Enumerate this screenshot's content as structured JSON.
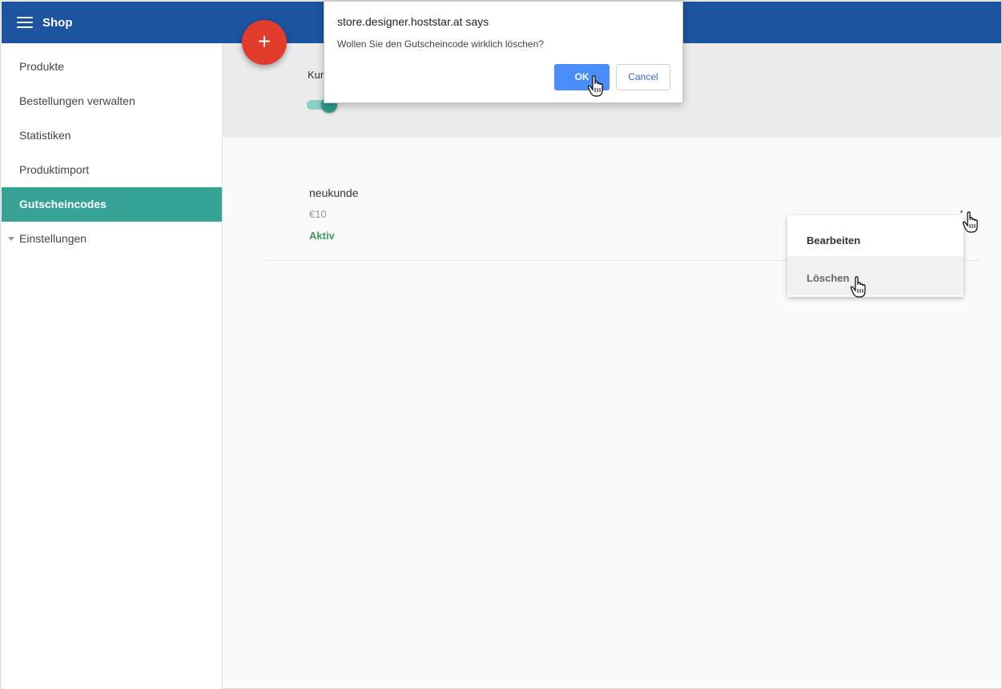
{
  "app": {
    "title": "Shop",
    "menu_icon": "hamburger-menu-icon"
  },
  "sidebar": {
    "items": [
      {
        "label": "Produkte"
      },
      {
        "label": "Bestellungen verwalten"
      },
      {
        "label": "Statistiken"
      },
      {
        "label": "Produktimport"
      },
      {
        "label": "Gutscheincodes",
        "active": true
      },
      {
        "label": "Einstellungen",
        "icon": "caret-down-icon"
      }
    ]
  },
  "main": {
    "header_label": "Kun",
    "fab_icon": "plus-icon",
    "fab_label": "+",
    "voucher": {
      "name": "neukunde",
      "value": "€10",
      "status": "Aktiv"
    }
  },
  "context_menu": {
    "items": [
      {
        "label": "Bearbeiten"
      },
      {
        "label": "Löschen"
      }
    ]
  },
  "dialog": {
    "title": "store.designer.hoststar.at says",
    "message": "Wollen Sie den Gutscheincode wirklich löschen?",
    "ok_label": "OK",
    "cancel_label": "Cancel"
  },
  "colors": {
    "appbar": "#1c54a0",
    "active_nav": "#37a397",
    "fab": "#e23c2c",
    "status_active": "#3e9a5a",
    "ok_button": "#4a8df8"
  }
}
